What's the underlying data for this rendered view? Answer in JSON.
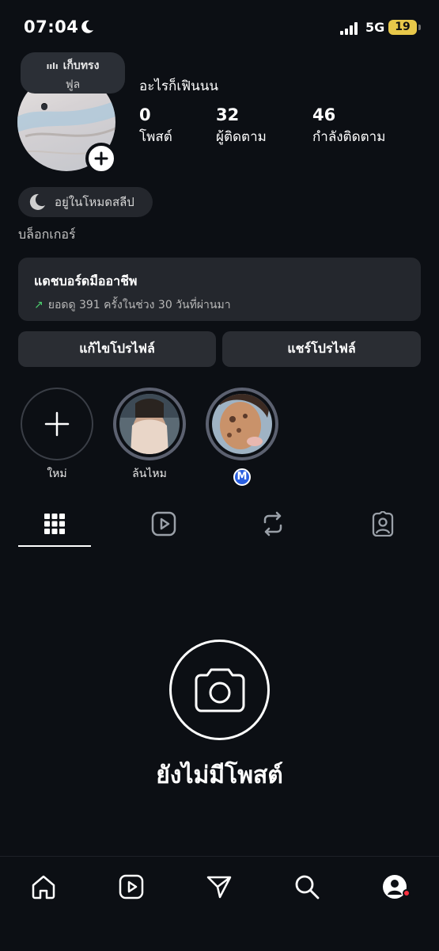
{
  "status_bar": {
    "time": "07:04",
    "network": "5G",
    "battery": "19"
  },
  "profile": {
    "note_line1": "เก็บทรง",
    "note_line2": "ฟูล",
    "display_name": "อะไรก็เฟินนน",
    "stats": [
      {
        "value": "0",
        "label": "โพสต์"
      },
      {
        "value": "32",
        "label": "ผู้ติดตาม"
      },
      {
        "value": "46",
        "label": "กำลังติดตาม"
      }
    ],
    "status_pill": "อยู่ในโหมดสลีป",
    "category": "บล็อกเกอร์"
  },
  "dashboard": {
    "title": "แดชบอร์ดมืออาชีพ",
    "subtitle": "ยอดดู 391 ครั้งในช่วง 30 วันที่ผ่านมา",
    "trend_color": "#4ccf6e"
  },
  "buttons": {
    "edit_profile": "แก้ไขโปรไฟล์",
    "share_profile": "แชร์โปรไฟล์"
  },
  "highlights": [
    {
      "label": "ใหม่",
      "icon": "plus-icon"
    },
    {
      "label": "ล้นไหม",
      "icon": ""
    },
    {
      "label": "",
      "badge": "M"
    }
  ],
  "tabs": [
    "grid-icon",
    "reels-icon",
    "reposts-icon",
    "tagged-icon"
  ],
  "empty_state": {
    "text": "ยังไม่มีโพสต์",
    "icon": "camera-icon"
  },
  "bottom_nav": [
    "home-icon",
    "reels-icon",
    "send-icon",
    "search-icon",
    "profile-icon"
  ],
  "colors": {
    "background": "#0c0f14",
    "card": "#24272d",
    "battery": "#e8c84a",
    "notification": "#ff3040"
  }
}
